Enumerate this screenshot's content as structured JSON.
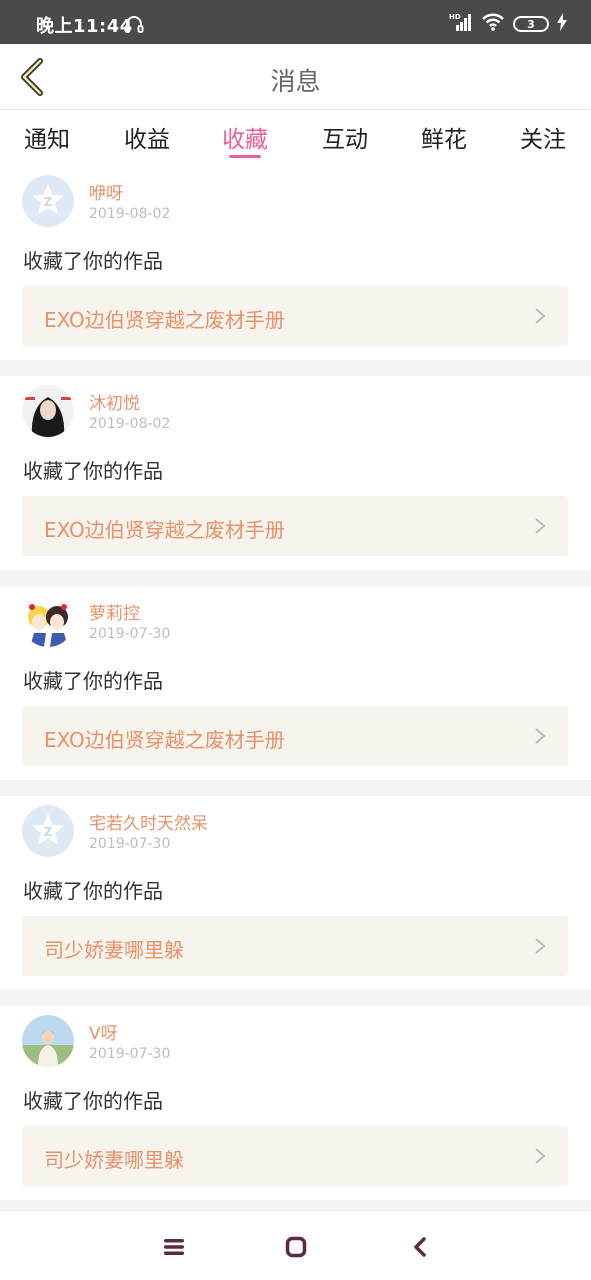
{
  "status_bar": {
    "time": "晚上11:44",
    "battery": "3"
  },
  "header": {
    "title": "消息"
  },
  "tabs": [
    {
      "label": "通知"
    },
    {
      "label": "收益"
    },
    {
      "label": "收藏",
      "active": true
    },
    {
      "label": "互动"
    },
    {
      "label": "鲜花"
    },
    {
      "label": "关注"
    }
  ],
  "messages": [
    {
      "username": "咿呀",
      "date": "2019-08-02",
      "action": "收藏了你的作品",
      "work_title": "EXO边伯贤穿越之废材手册",
      "avatar": "default-avatar"
    },
    {
      "username": "沐初悦",
      "date": "2019-08-02",
      "action": "收藏了你的作品",
      "work_title": "EXO边伯贤穿越之废材手册",
      "avatar": "photo-avatar"
    },
    {
      "username": "萝莉控",
      "date": "2019-07-30",
      "action": "收藏了你的作品",
      "work_title": "EXO边伯贤穿越之废材手册",
      "avatar": "anime-avatar"
    },
    {
      "username": "宅若久时天然呆",
      "date": "2019-07-30",
      "action": "收藏了你的作品",
      "work_title": "司少娇妻哪里躲",
      "avatar": "default-avatar"
    },
    {
      "username": "V呀",
      "date": "2019-07-30",
      "action": "收藏了你的作品",
      "work_title": "司少娇妻哪里躲",
      "avatar": "photo-avatar"
    }
  ],
  "colors": {
    "accent": "#e8609a",
    "username": "#e9916a",
    "work_bg": "#f6f4ec"
  },
  "icons": {
    "back": "chevron-left-icon",
    "arrow": "chevron-right-icon",
    "nav_menu": "menu-icon",
    "nav_home": "home-icon",
    "nav_back": "back-icon"
  }
}
